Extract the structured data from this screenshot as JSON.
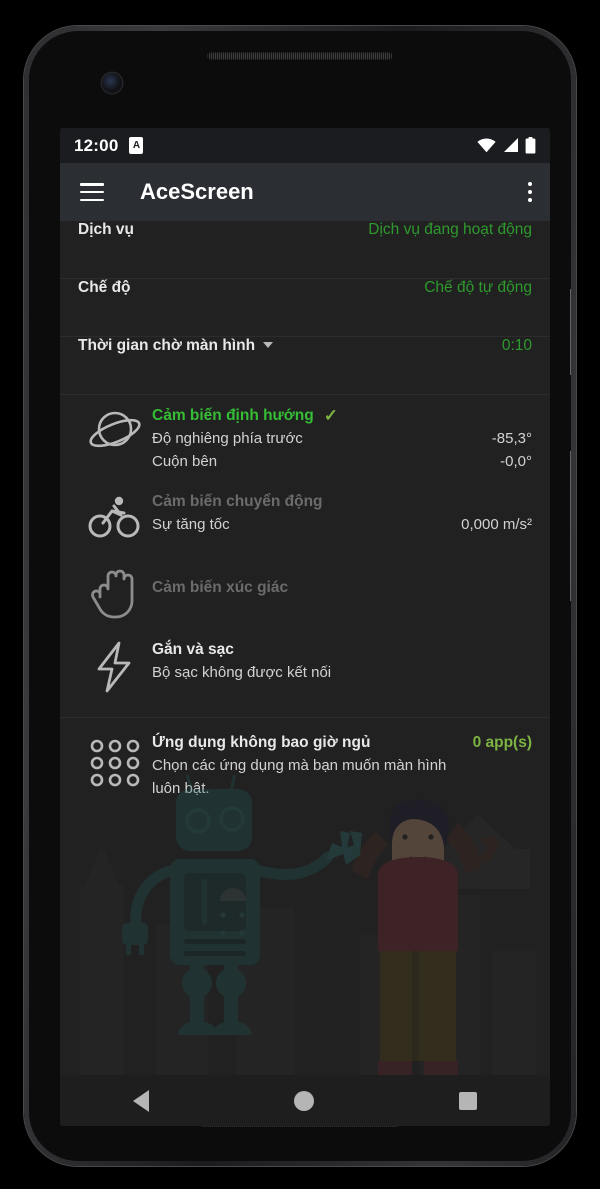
{
  "status_bar": {
    "time": "12:00",
    "alarm_badge": "A",
    "icons": [
      "wifi-icon",
      "cellular-signal-icon",
      "battery-icon"
    ]
  },
  "toolbar": {
    "menu_icon": "hamburger-menu-icon",
    "title": "AceScreen",
    "overflow_icon": "overflow-menu-icon"
  },
  "preferences": [
    {
      "label": "Dịch vụ",
      "value": "Dịch vụ đang hoạt động"
    },
    {
      "label": "Chế độ",
      "value": "Chế độ tự động"
    },
    {
      "label": "Thời gian chờ màn hình",
      "value": "0:10",
      "has_dropdown": true
    }
  ],
  "sensors": {
    "orientation": {
      "icon": "planet-icon",
      "title": "Cảm biến định hướng",
      "check": "✓",
      "rows": [
        {
          "label": "Độ nghiêng phía trước",
          "value": "-85,3°"
        },
        {
          "label": "Cuộn bên",
          "value": "-0,0°"
        }
      ]
    },
    "motion": {
      "icon": "bicycle-icon",
      "title": "Cảm biến chuyển động",
      "rows": [
        {
          "label": "Sự tăng tốc",
          "value": "0,000 m/s²"
        }
      ]
    },
    "touch": {
      "icon": "hand-icon",
      "title": "Cảm biến xúc giác"
    },
    "charging": {
      "icon": "lightning-bolt-icon",
      "title": "Gắn và sạc",
      "rows": [
        {
          "label": "Bộ sạc không được kết nối",
          "value": ""
        }
      ]
    }
  },
  "never_sleep_apps": {
    "icon": "app-grid-icon",
    "title": "Ứng dụng không bao giờ ngủ",
    "count": "0 app(s)",
    "description": "Chọn các ứng dụng mà bạn muốn màn hình luôn bật."
  },
  "nav_bar": {
    "back": "nav-back-icon",
    "home": "nav-home-icon",
    "recents": "nav-recents-icon"
  },
  "colors": {
    "accent_green": "#2e9a2e",
    "active_green": "#35bd35",
    "lime": "#7cb342",
    "background": "#212121",
    "toolbar": "#2b2e32",
    "status_bar": "#1a1c1f",
    "text_primary": "#e8e8e8",
    "text_secondary": "#d2d2d2",
    "text_muted": "#6b6b6b"
  }
}
